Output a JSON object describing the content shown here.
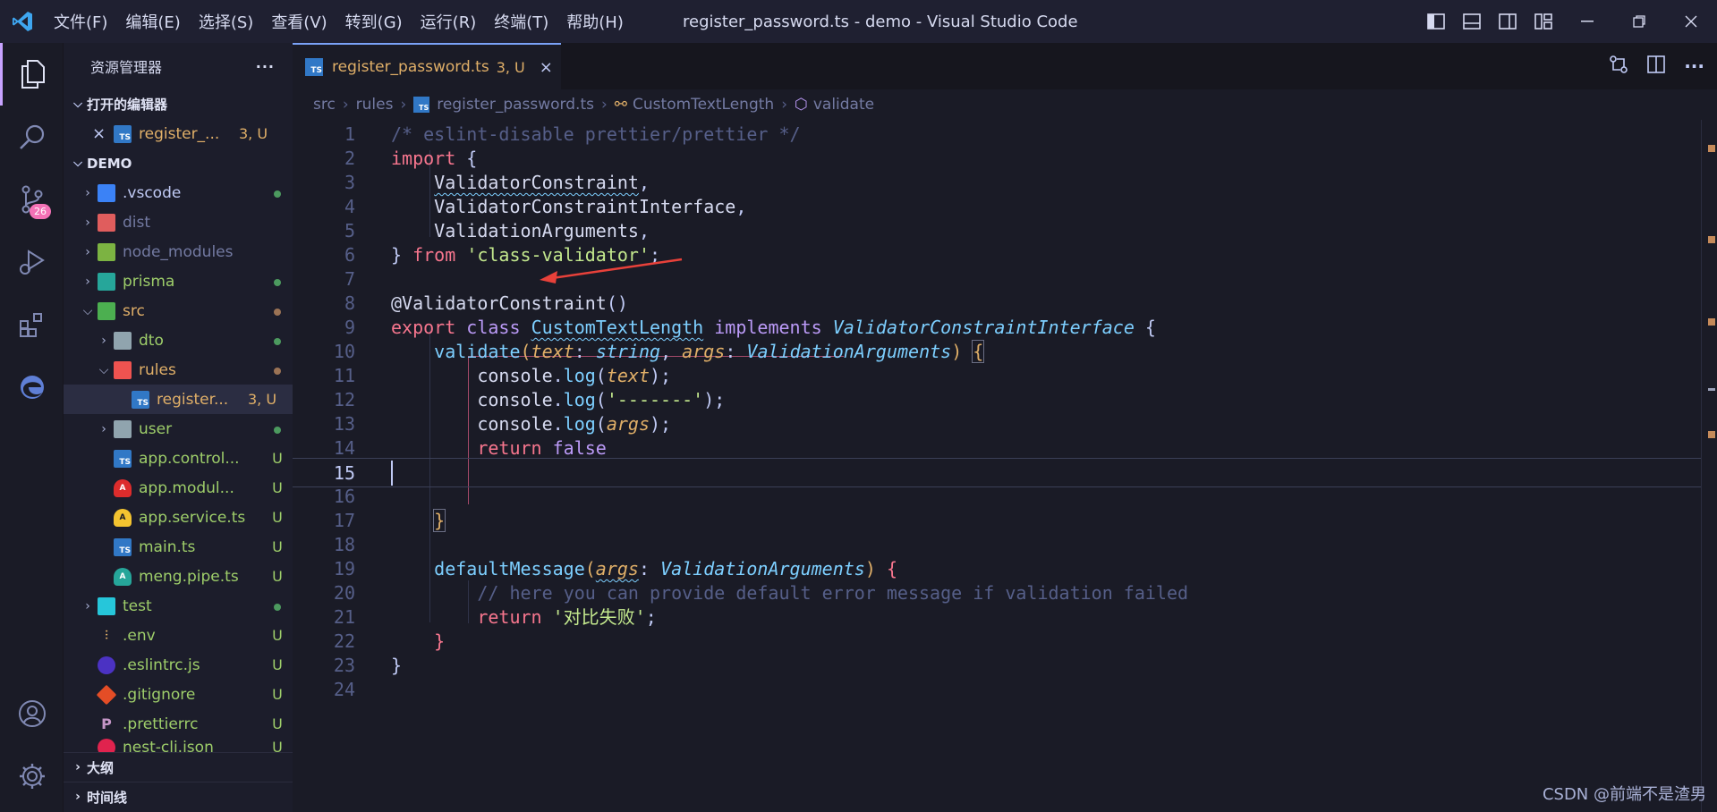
{
  "window": {
    "title": "register_password.ts - demo - Visual Studio Code",
    "menu": [
      "文件(F)",
      "编辑(E)",
      "选择(S)",
      "查看(V)",
      "转到(G)",
      "运行(R)",
      "终端(T)",
      "帮助(H)"
    ]
  },
  "activity_bar": {
    "items": [
      "explorer-icon",
      "search-icon",
      "source-control-icon",
      "run-debug-icon",
      "extensions-icon",
      "edge-icon"
    ],
    "source_control_badge": "26",
    "bottom": [
      "account-icon",
      "settings-icon"
    ]
  },
  "sidebar": {
    "title": "资源管理器",
    "more": "···",
    "open_editors": {
      "label": "打开的编辑器",
      "items": [
        {
          "close": "×",
          "name": "register_...",
          "status": "3, U"
        }
      ]
    },
    "workspace": {
      "label": "DEMO",
      "items": [
        {
          "name": ".vscode",
          "status": "",
          "icon": "vscode"
        },
        {
          "name": "dist",
          "status": "",
          "icon": "dist"
        },
        {
          "name": "node_modules",
          "status": "",
          "icon": "node"
        },
        {
          "name": "prisma",
          "status": "",
          "icon": "prisma"
        },
        {
          "name": "src",
          "status": "",
          "icon": "src"
        },
        {
          "name": "dto",
          "status": "",
          "icon": "folder"
        },
        {
          "name": "rules",
          "status": "",
          "icon": "rules"
        },
        {
          "name": "register...",
          "status": "3, U",
          "icon": "TS"
        },
        {
          "name": "user",
          "status": "",
          "icon": "folder"
        },
        {
          "name": "app.control...",
          "status": "U",
          "icon": "TS"
        },
        {
          "name": "app.modul...",
          "status": "U",
          "icon": "A"
        },
        {
          "name": "app.service.ts",
          "status": "U",
          "icon": "A"
        },
        {
          "name": "main.ts",
          "status": "U",
          "icon": "TS"
        },
        {
          "name": "meng.pipe.ts",
          "status": "U",
          "icon": "A"
        },
        {
          "name": "test",
          "status": "",
          "icon": "test"
        },
        {
          "name": ".env",
          "status": "U",
          "icon": "env"
        },
        {
          "name": ".eslintrc.js",
          "status": "U",
          "icon": "eslint"
        },
        {
          "name": ".gitignore",
          "status": "U",
          "icon": "git"
        },
        {
          "name": ".prettierrc",
          "status": "U",
          "icon": "prettier"
        },
        {
          "name": "nest-cli.json",
          "status": "U",
          "icon": "nest"
        }
      ]
    },
    "outline_label": "大纲",
    "timeline_label": "时间线"
  },
  "editor": {
    "tab": {
      "name": "register_password.ts",
      "status": "3, U",
      "close": "×"
    },
    "breadcrumb": [
      "src",
      "rules",
      "register_password.ts",
      "CustomTextLength",
      "validate"
    ],
    "current_line": 15,
    "line_numbers": [
      "1",
      "2",
      "3",
      "4",
      "5",
      "6",
      "7",
      "8",
      "9",
      "10",
      "11",
      "12",
      "13",
      "14",
      "15",
      "16",
      "17",
      "18",
      "19",
      "20",
      "21",
      "22",
      "23",
      "24"
    ],
    "code": {
      "l1": "/* eslint-disable prettier/prettier */",
      "l2_kw": "import",
      "l3": "ValidatorConstraint",
      "l4": "ValidatorConstraintInterface",
      "l5": "ValidationArguments",
      "l6_from": "from",
      "l6_str": "'class-validator'",
      "l8": "@ValidatorConstraint",
      "l9_export": "export",
      "l9_class": "class",
      "l9_name": "CustomTextLength",
      "l9_impl": "implements",
      "l9_iface": "ValidatorConstraintInterface",
      "l10_fn": "validate",
      "l10_p1": "text",
      "l10_t1": "string",
      "l10_p2": "args",
      "l10_t2": "ValidationArguments",
      "console": "console",
      "log": "log",
      "l12_str": "'-------'",
      "l14_ret": "return",
      "l14_val": "false",
      "l19_fn": "defaultMessage",
      "l20": "// here you can provide default error message if validation failed",
      "l21_str": "'对比失败'"
    }
  },
  "watermark": "CSDN @前端不是渣男"
}
